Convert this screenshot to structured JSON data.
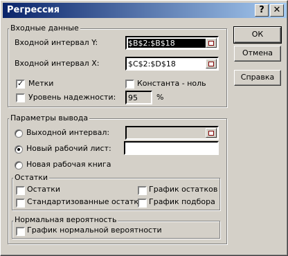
{
  "window": {
    "title": "Регрессия",
    "help_btn": "?",
    "close_btn": "✕"
  },
  "input_group": {
    "title": "Входные данные",
    "y_label": "Входной интервал Y:",
    "y_value": "$B$2:$B$18",
    "x_label": "Входной интервал X:",
    "x_value": "$C$2:$D$18",
    "labels_checkbox": "Метки",
    "labels_checked": true,
    "const_checkbox": "Константа - ноль",
    "const_checked": false,
    "confidence_checkbox": "Уровень надежности:",
    "confidence_checked": false,
    "confidence_value": "95",
    "percent": "%"
  },
  "output_group": {
    "title": "Параметры вывода",
    "output_range_label": "Выходной интервал:",
    "output_range_value": "",
    "new_sheet_label": "Новый рабочий лист:",
    "new_sheet_value": "",
    "new_book_label": "Новая рабочая книга",
    "selected": "new_sheet"
  },
  "residuals_group": {
    "title": "Остатки",
    "residuals": "Остатки",
    "std_residuals": "Стандартизованные остатки",
    "residual_plots": "График остатков",
    "fit_plots": "График подбора"
  },
  "normal_group": {
    "title": "Нормальная вероятность",
    "normal_plot": "График нормальной вероятности"
  },
  "buttons": {
    "ok": "ОК",
    "cancel": "Отмена",
    "help": "Справка"
  }
}
